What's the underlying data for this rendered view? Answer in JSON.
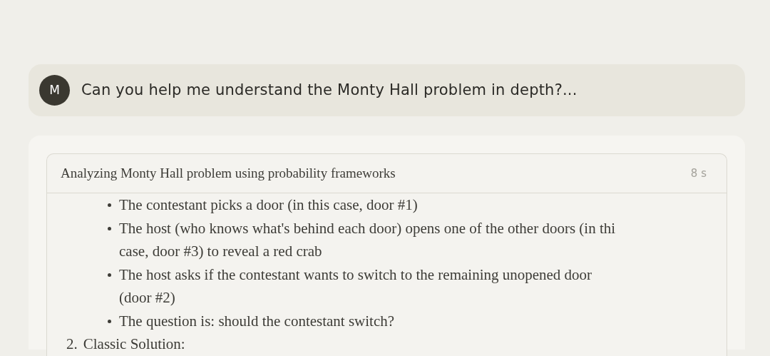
{
  "user_message": {
    "avatar": "M",
    "text": "Can you help me understand the Monty Hall problem in depth?..."
  },
  "thinking": {
    "title": "Analyzing Monty Hall problem using probability frameworks",
    "duration": "8 s",
    "content": [
      {
        "kind": "bullet",
        "lines": [
          "The contestant picks a door (in this case, door #1)"
        ]
      },
      {
        "kind": "bullet",
        "lines": [
          "The host (who knows what's behind each door) opens one of the other doors (in thi",
          "case, door #3) to reveal a red crab"
        ]
      },
      {
        "kind": "bullet",
        "lines": [
          "The host asks if the contestant wants to switch to the remaining unopened door",
          "(door #2)"
        ]
      },
      {
        "kind": "bullet",
        "lines": [
          "The question is: should the contestant switch?"
        ]
      },
      {
        "kind": "numbered",
        "number": "2.",
        "lines": [
          "Classic Solution:"
        ]
      }
    ]
  }
}
